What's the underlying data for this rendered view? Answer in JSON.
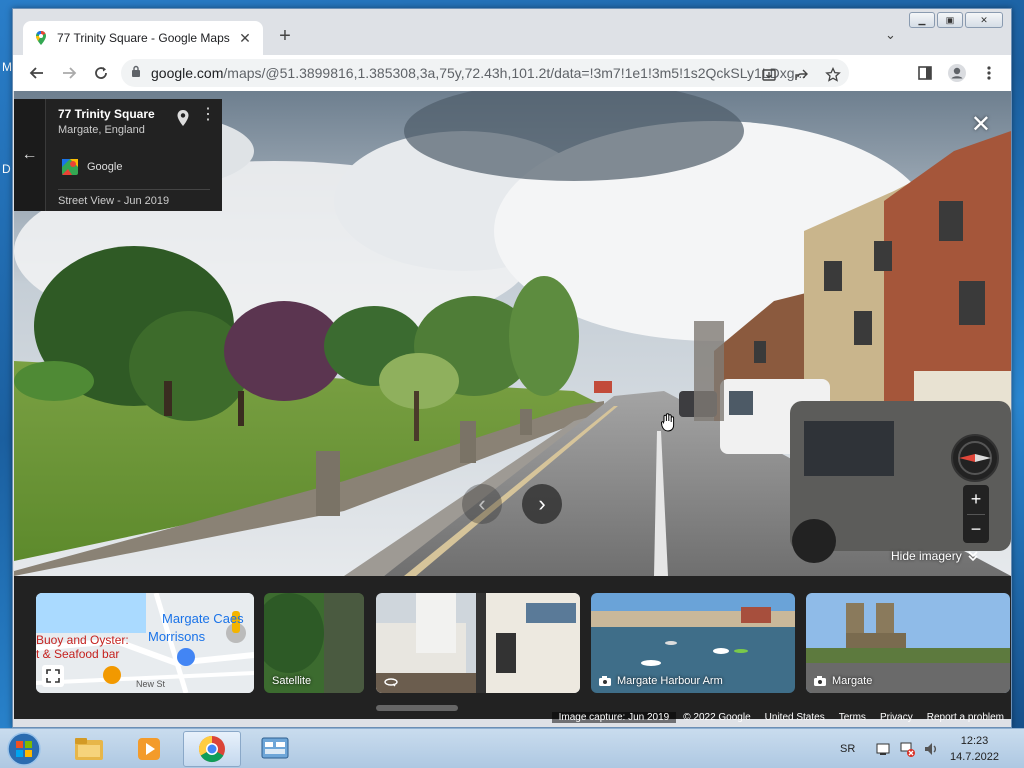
{
  "browser": {
    "tab_title": "77 Trinity Square - Google Maps",
    "url_host": "google.com",
    "url_path": "/maps/@51.3899816,1.385308,3a,75y,72.43h,101.2t/data=!3m7!1e1!3m5!1s2QckSLy1LDxg..."
  },
  "info_card": {
    "address": "77 Trinity Square",
    "city": "Margate, England",
    "provider": "Google",
    "date": "Street View - Jun 2019"
  },
  "controls": {
    "hide_imagery": "Hide imagery"
  },
  "thumbnails": {
    "map": {
      "place1": "Margate Ca",
      "place1b": "es",
      "place2": "Buoy and Oyster:",
      "place3": "Morrisons",
      "place4": "t & Seafood bar",
      "street": "New St"
    },
    "satellite": "Satellite",
    "harbour": "Margate Harbour Arm",
    "margate": "Margate"
  },
  "footer": {
    "capture": "Image capture: Jun 2019",
    "copyright": "© 2022 Google",
    "country": "United States",
    "terms": "Terms",
    "privacy": "Privacy",
    "report": "Report a problem"
  },
  "taskbar": {
    "language": "SR",
    "time": "12:23",
    "date": "14.7.2022"
  },
  "colors": {
    "maps_dark": "#222222",
    "chrome_frame": "#dee1e6",
    "sky": "#c9d3dc",
    "grass": "#6f9a3c",
    "road": "#8e8e8e"
  }
}
